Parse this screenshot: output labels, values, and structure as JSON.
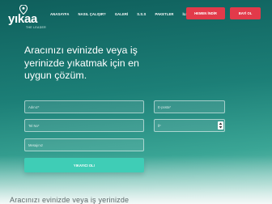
{
  "brand": {
    "name": "yıkaa",
    "tagline": "THE LEADER"
  },
  "nav": {
    "items": [
      "ANASAYFA",
      "NASIL ÇALIŞIR?",
      "GALERİ",
      "S.S.S",
      "PAKETLER",
      "İLETİŞİM"
    ],
    "download_label": "HEMEN İNDİR",
    "dealer_label": "BAYİ OL"
  },
  "hero": {
    "headline_lines": [
      "Aracınızı evinizde veya iş",
      "yerinizde yıkatmak için en",
      "uygun çözüm."
    ]
  },
  "form": {
    "name_placeholder": "Adınız*",
    "email_placeholder": "E-posta*",
    "phone_placeholder": "Tel No*",
    "city_selected": "İl*",
    "message_placeholder": "Mesajınız",
    "submit_label": "YIKAYICI OL!"
  },
  "footer_fragment": "Aracınızı evinizde veya iş yerinizde",
  "colors": {
    "accent": "#e23a4a",
    "submit": "#3fcdb6",
    "bg_top": "#0f5f5c"
  }
}
